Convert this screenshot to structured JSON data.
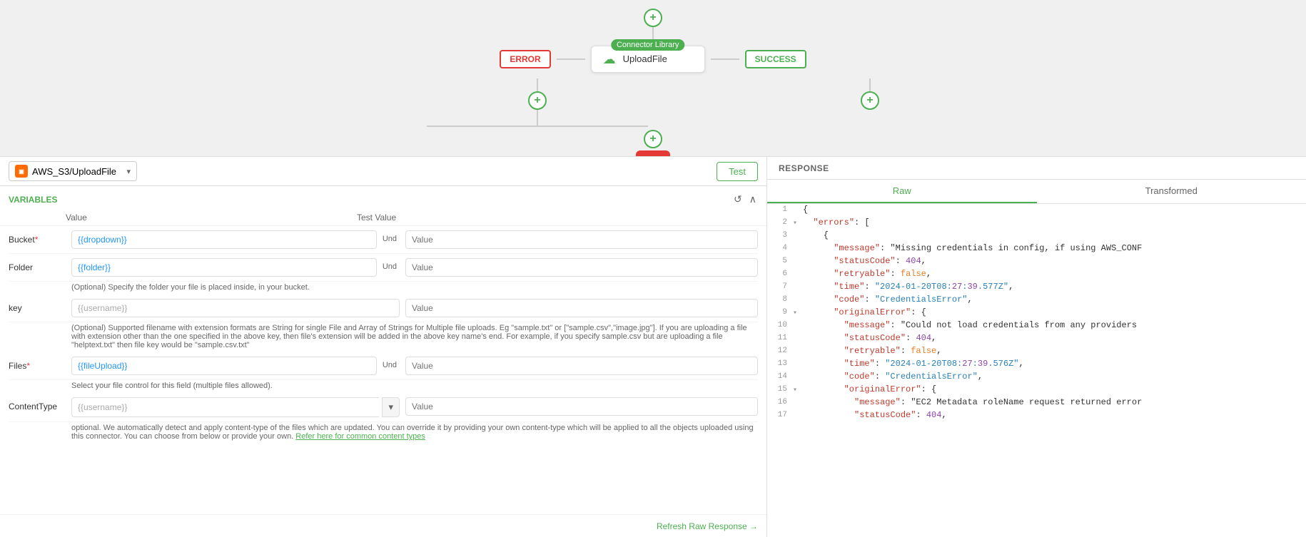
{
  "canvas": {
    "add_top_label": "+",
    "connector_library_label": "Connector Library",
    "error_label": "ERROR",
    "node_icon": "☁",
    "node_name": "UploadFile",
    "success_label": "SUCCESS",
    "add_bottom_error_label": "+",
    "add_bottom_success_label": "+"
  },
  "toolbar": {
    "dropdown_value": "AWS_S3/UploadFile",
    "test_label": "Test"
  },
  "variables": {
    "title": "VARIABLES",
    "col_value": "Value",
    "col_test": "Test Value",
    "refresh_icon": "↺",
    "collapse_icon": "∧",
    "rows": [
      {
        "label": "Bucket",
        "required": true,
        "value": "{{dropdown}}",
        "test_value": "Value",
        "und_label": "Und",
        "desc": ""
      },
      {
        "label": "Folder",
        "required": false,
        "value": "{{folder}}",
        "test_value": "Value",
        "und_label": "Und",
        "desc": "(Optional) Specify the folder your file is placed inside, in your bucket."
      },
      {
        "label": "key",
        "required": false,
        "value": "{{username}}",
        "test_value": "Value",
        "und_label": "",
        "desc": "(Optional) Supported filename with extension formats are String for single File and Array of Strings for Multiple file uploads. Eg \"sample.txt\" or [\"sample.csv\",\"image.jpg\"]. If you are uploading a file with extension other than the one specified in the above key, then file's extension will be added in the above key name's end. For example, if you specify sample.csv but are uploading a file \"helptext.txt\" then file key would be \"sample.csv.txt\""
      },
      {
        "label": "Files",
        "required": true,
        "value": "{{fileUpload}}",
        "test_value": "Value",
        "und_label": "Und",
        "desc": "Select your file control for this field (multiple files allowed)."
      },
      {
        "label": "ContentType",
        "required": false,
        "value": "{{username}}",
        "test_value": "Value",
        "und_label": "",
        "has_dropdown": true,
        "desc": "optional. We automatically detect and apply content-type of the files which are updated. You can override it by providing your own content-type which will be applied to all the objects uploaded using this connector. You can choose from below or provide your own.",
        "desc_link": "Refer here for common content types"
      }
    ]
  },
  "response": {
    "title": "RESPONSE",
    "tab_raw": "Raw",
    "tab_transformed": "Transformed",
    "refresh_label": "Refresh Raw Response →",
    "lines": [
      {
        "num": "1",
        "expandable": false,
        "content": "{"
      },
      {
        "num": "2",
        "expandable": true,
        "content": "  \"errors\": ["
      },
      {
        "num": "3",
        "expandable": false,
        "content": "    {"
      },
      {
        "num": "4",
        "expandable": false,
        "content": "      \"message\": \"Missing credentials in config, if using AWS_CONF"
      },
      {
        "num": "5",
        "expandable": false,
        "content": "      \"statusCode\": 404,"
      },
      {
        "num": "6",
        "expandable": false,
        "content": "      \"retryable\": false,"
      },
      {
        "num": "7",
        "expandable": false,
        "content": "      \"time\": \"2024-01-20T08:27:39.577Z\","
      },
      {
        "num": "8",
        "expandable": false,
        "content": "      \"code\": \"CredentialsError\","
      },
      {
        "num": "9",
        "expandable": true,
        "content": "      \"originalError\": {"
      },
      {
        "num": "10",
        "expandable": false,
        "content": "        \"message\": \"Could not load credentials from any providers"
      },
      {
        "num": "11",
        "expandable": false,
        "content": "        \"statusCode\": 404,"
      },
      {
        "num": "12",
        "expandable": false,
        "content": "        \"retryable\": false,"
      },
      {
        "num": "13",
        "expandable": false,
        "content": "        \"time\": \"2024-01-20T08:27:39.576Z\","
      },
      {
        "num": "14",
        "expandable": false,
        "content": "        \"code\": \"CredentialsError\","
      },
      {
        "num": "15",
        "expandable": true,
        "content": "        \"originalError\": {"
      },
      {
        "num": "16",
        "expandable": false,
        "content": "          \"message\": \"EC2 Metadata roleName request returned error"
      },
      {
        "num": "17",
        "expandable": false,
        "content": "          \"statusCode\": 404,"
      }
    ]
  }
}
